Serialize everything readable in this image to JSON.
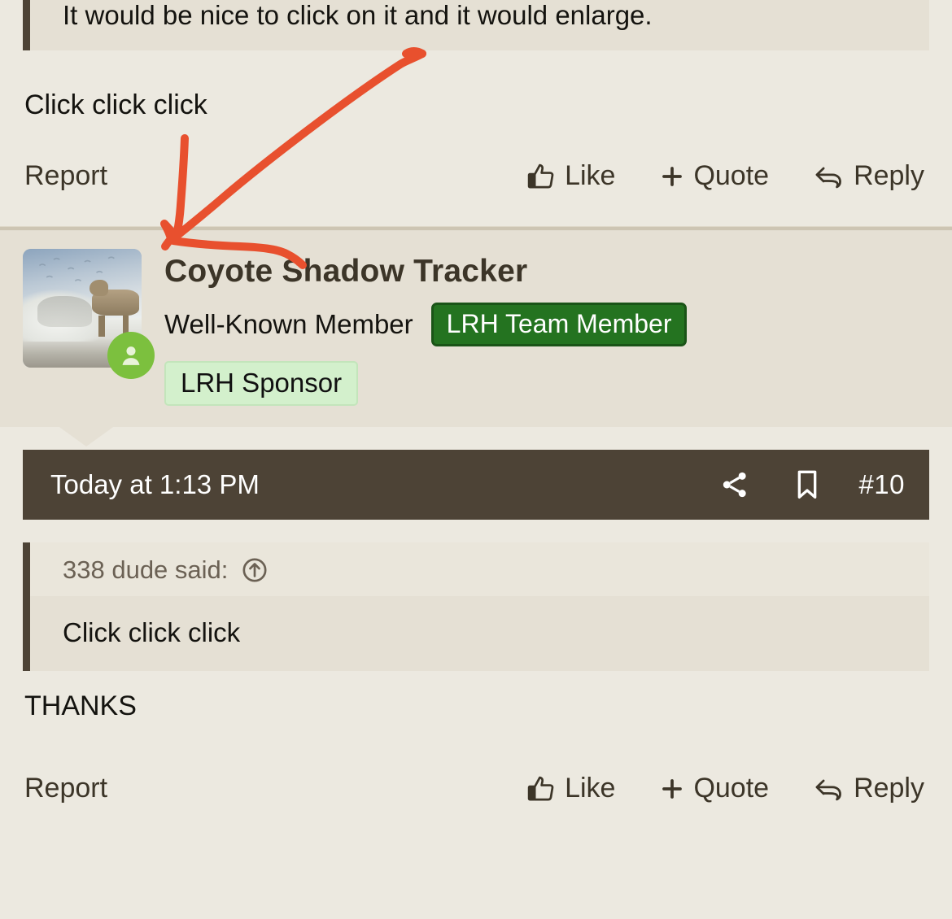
{
  "colors": {
    "page_bg": "#ece9e0",
    "block_bg": "#e5e0d4",
    "bar_dark": "#4d4336",
    "divider": "#cdc5b3",
    "badge_team_bg": "#247320",
    "badge_sponsor_bg": "#d3f0cc",
    "online_green": "#7cc03e",
    "annotation_red": "#e8502e",
    "text": "#14130f"
  },
  "post_previous": {
    "quote_text": "It would be nice to click on it and it would enlarge.",
    "body_text": "Click click click",
    "actions": {
      "report_label": "Report",
      "like_label": "Like",
      "quote_label": "Quote",
      "reply_label": "Reply"
    }
  },
  "annotation": {
    "type": "handdrawn-arrow",
    "color": "#e8502e",
    "description": "red hand-drawn arrow pointing down-left toward the post body area"
  },
  "post_current": {
    "user": {
      "name": "Coyote Shadow Tracker",
      "title": "Well-Known Member",
      "badges": [
        {
          "label": "LRH Team Member",
          "style": "solid-green"
        },
        {
          "label": "LRH Sponsor",
          "style": "light-green"
        }
      ],
      "avatar_alt": "coyote-in-snow-avatar",
      "online_status": "online"
    },
    "header": {
      "timestamp": "Today at 1:13 PM",
      "share_icon": "share-icon",
      "bookmark_icon": "bookmark-icon",
      "post_number": "#10"
    },
    "quote": {
      "attribution": "338 dude said:",
      "jump_icon": "circle-up-arrow-icon",
      "text": "Click click click"
    },
    "body_text": "THANKS",
    "actions": {
      "report_label": "Report",
      "like_label": "Like",
      "quote_label": "Quote",
      "reply_label": "Reply"
    }
  }
}
